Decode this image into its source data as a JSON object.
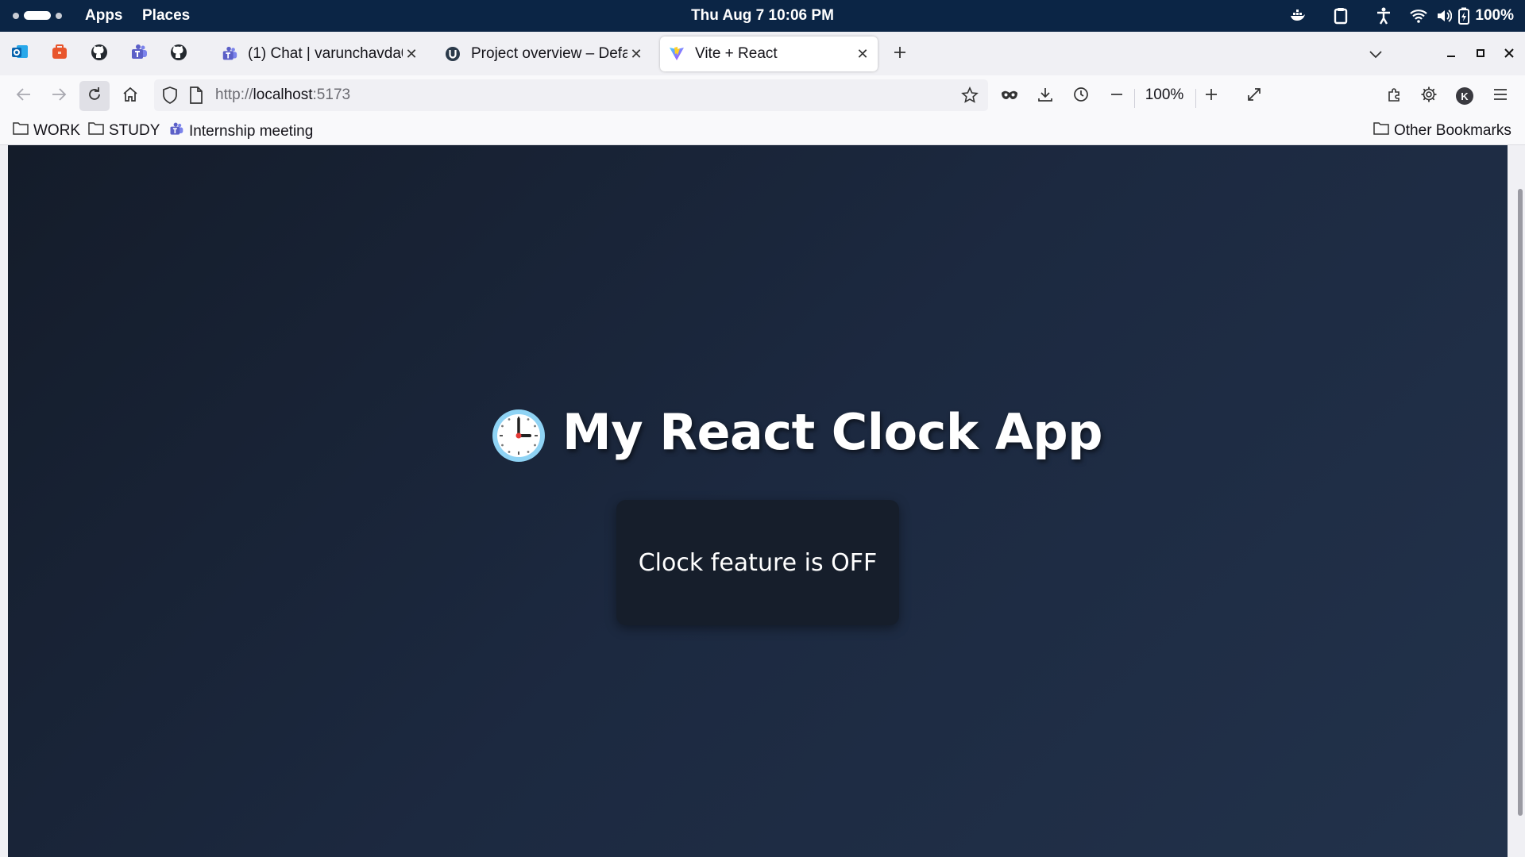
{
  "system_bar": {
    "apps_label": "Apps",
    "places_label": "Places",
    "datetime": "Thu Aug 7  10:06 PM",
    "battery": "100%"
  },
  "tabs": [
    {
      "title": "(1) Chat | varunchavda0",
      "icon": "teams-icon"
    },
    {
      "title": "Project overview – Defau",
      "icon": "project-u-icon"
    },
    {
      "title": "Vite + React",
      "icon": "vite-icon",
      "active": true
    }
  ],
  "pinned_tabs": [
    "outlook-icon",
    "orange-app-icon",
    "github-icon",
    "teams-icon",
    "github-icon"
  ],
  "address_bar": {
    "url_scheme": "http://",
    "url_host": "localhost",
    "url_port": ":5173"
  },
  "zoom_level": "100%",
  "bookmarks": [
    {
      "label": "WORK",
      "icon": "folder-icon"
    },
    {
      "label": "STUDY",
      "icon": "folder-icon"
    },
    {
      "label": "Internship meeting",
      "icon": "teams-icon"
    }
  ],
  "other_bookmarks": "Other Bookmarks",
  "profile_initial": "K",
  "page": {
    "title": "My React Clock App",
    "status_text": "Clock feature is OFF"
  },
  "colors": {
    "system_bar": "#0b2545",
    "page_bg_start": "#141c2a",
    "page_bg_end": "#22324b",
    "card_bg": "#161e2b",
    "teams_purple": "#5b5fc7"
  }
}
